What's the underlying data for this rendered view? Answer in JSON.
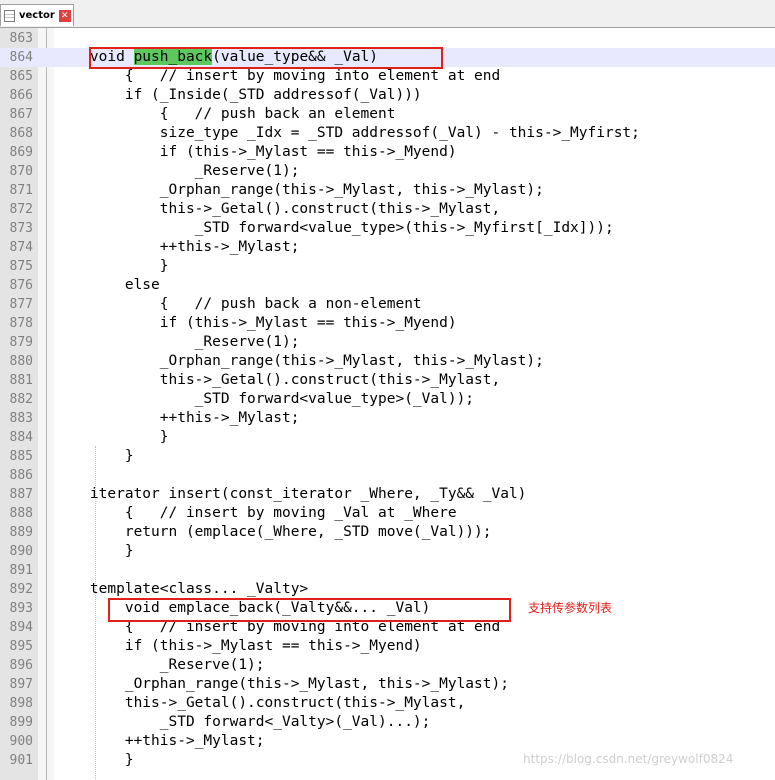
{
  "tab": {
    "label": "vector",
    "icon": "document-icon",
    "close_icon": "close-icon"
  },
  "note": "支持传参数列表",
  "watermark": "https://blog.csdn.net/greywolf0824",
  "colors": {
    "highlight": "#5ec85e",
    "annotation": "#e0201a",
    "active_line": "#e8e8ff"
  },
  "lines": [
    {
      "num": "863",
      "text": ""
    },
    {
      "num": "864",
      "text": "    void push_back(value_type&& _Val)"
    },
    {
      "num": "865",
      "text": "        {   // insert by moving into element at end"
    },
    {
      "num": "866",
      "text": "        if (_Inside(_STD addressof(_Val)))"
    },
    {
      "num": "867",
      "text": "            {   // push back an element"
    },
    {
      "num": "868",
      "text": "            size_type _Idx = _STD addressof(_Val) - this->_Myfirst;"
    },
    {
      "num": "869",
      "text": "            if (this->_Mylast == this->_Myend)"
    },
    {
      "num": "870",
      "text": "                _Reserve(1);"
    },
    {
      "num": "871",
      "text": "            _Orphan_range(this->_Mylast, this->_Mylast);"
    },
    {
      "num": "872",
      "text": "            this->_Getal().construct(this->_Mylast,"
    },
    {
      "num": "873",
      "text": "                _STD forward<value_type>(this->_Myfirst[_Idx]));"
    },
    {
      "num": "874",
      "text": "            ++this->_Mylast;"
    },
    {
      "num": "875",
      "text": "            }"
    },
    {
      "num": "876",
      "text": "        else"
    },
    {
      "num": "877",
      "text": "            {   // push back a non-element"
    },
    {
      "num": "878",
      "text": "            if (this->_Mylast == this->_Myend)"
    },
    {
      "num": "879",
      "text": "                _Reserve(1);"
    },
    {
      "num": "880",
      "text": "            _Orphan_range(this->_Mylast, this->_Mylast);"
    },
    {
      "num": "881",
      "text": "            this->_Getal().construct(this->_Mylast,"
    },
    {
      "num": "882",
      "text": "                _STD forward<value_type>(_Val));"
    },
    {
      "num": "883",
      "text": "            ++this->_Mylast;"
    },
    {
      "num": "884",
      "text": "            }"
    },
    {
      "num": "885",
      "text": "        }"
    },
    {
      "num": "886",
      "text": ""
    },
    {
      "num": "887",
      "text": "    iterator insert(const_iterator _Where, _Ty&& _Val)"
    },
    {
      "num": "888",
      "text": "        {   // insert by moving _Val at _Where"
    },
    {
      "num": "889",
      "text": "        return (emplace(_Where, _STD move(_Val)));"
    },
    {
      "num": "890",
      "text": "        }"
    },
    {
      "num": "891",
      "text": ""
    },
    {
      "num": "892",
      "text": "    template<class... _Valty>"
    },
    {
      "num": "893",
      "text": "        void emplace_back(_Valty&&... _Val)"
    },
    {
      "num": "894",
      "text": "        {   // insert by moving into element at end"
    },
    {
      "num": "895",
      "text": "        if (this->_Mylast == this->_Myend)"
    },
    {
      "num": "896",
      "text": "            _Reserve(1);"
    },
    {
      "num": "897",
      "text": "        _Orphan_range(this->_Mylast, this->_Mylast);"
    },
    {
      "num": "898",
      "text": "        this->_Getal().construct(this->_Mylast,"
    },
    {
      "num": "899",
      "text": "            _STD forward<_Valty>(_Val)...);"
    },
    {
      "num": "900",
      "text": "        ++this->_Mylast;"
    },
    {
      "num": "901",
      "text": "        }"
    }
  ],
  "line_864_parts": {
    "pre": "    void ",
    "highlight": "push_back",
    "post": "(value_type&& _Val)"
  }
}
